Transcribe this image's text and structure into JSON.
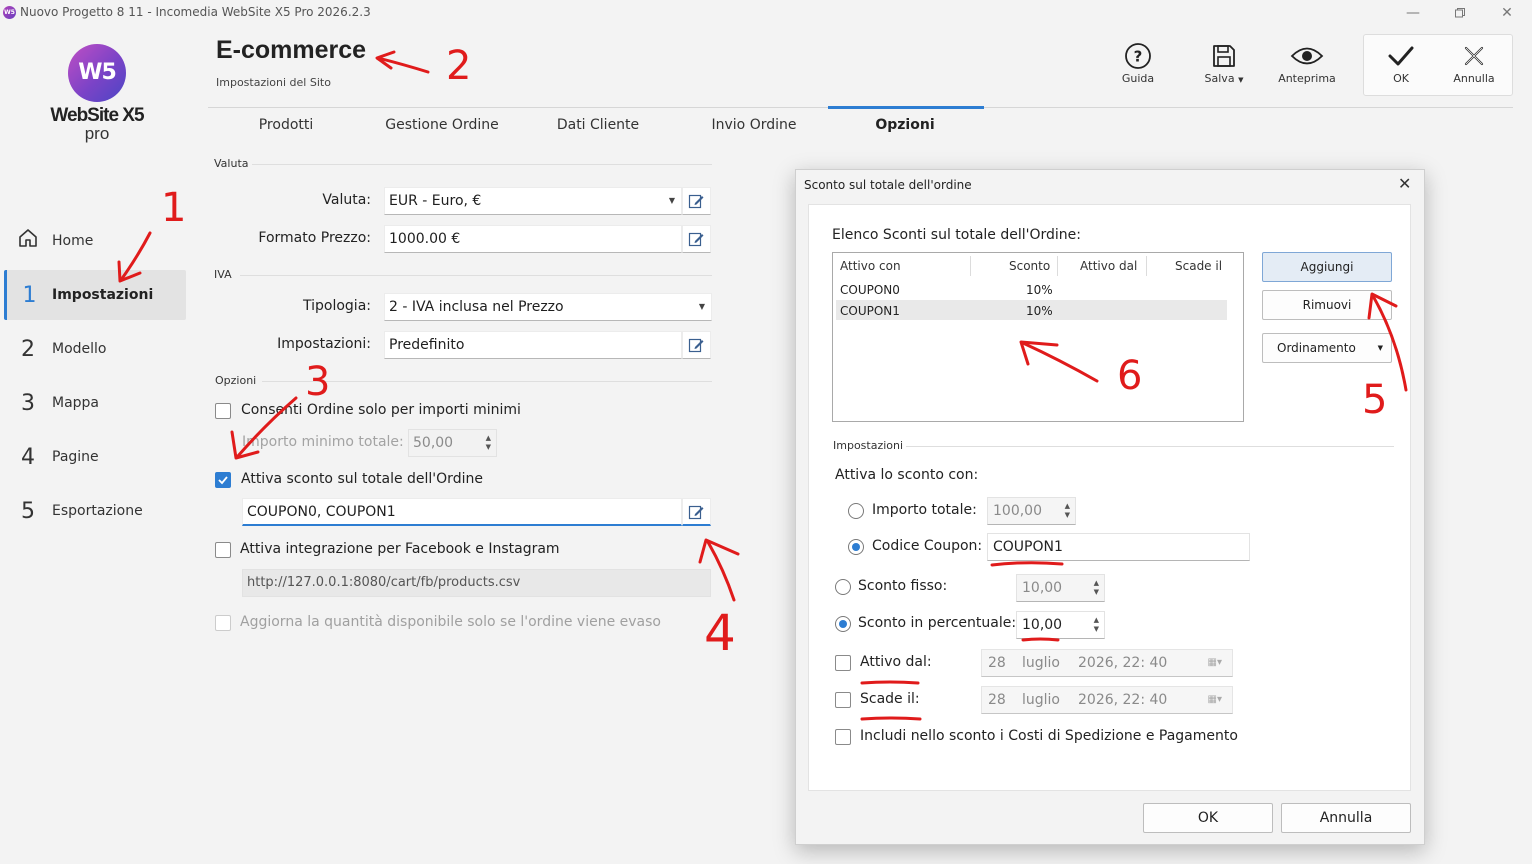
{
  "window": {
    "title": "Nuovo Progetto 8 11 - Incomedia WebSite X5 Pro 2026.2.3",
    "icon_label": "W5",
    "controls": [
      "minimize-icon",
      "restore-icon",
      "close-icon"
    ]
  },
  "logo": {
    "mark": "W5",
    "name": "WebSite X5",
    "edition": "pro"
  },
  "sidebar": {
    "items": [
      {
        "num": "",
        "label": "Home",
        "icon": "home-icon"
      },
      {
        "num": "1",
        "label": "Impostazioni"
      },
      {
        "num": "2",
        "label": "Modello"
      },
      {
        "num": "3",
        "label": "Mappa"
      },
      {
        "num": "4",
        "label": "Pagine"
      },
      {
        "num": "5",
        "label": "Esportazione"
      }
    ],
    "active_index": 1
  },
  "header": {
    "title": "E-commerce",
    "subtitle": "Impostazioni del Sito"
  },
  "toolbar": {
    "guida": "Guida",
    "salva": "Salva",
    "anteprima": "Anteprima",
    "ok": "OK",
    "annulla": "Annulla"
  },
  "tabs": [
    "Prodotti",
    "Gestione Ordine",
    "Dati Cliente",
    "Invio Ordine",
    "Opzioni"
  ],
  "form": {
    "valuta_section": "Valuta",
    "valuta_label": "Valuta:",
    "valuta_value": "EUR - Euro, €",
    "formato_label": "Formato Prezzo:",
    "formato_value": "1000.00 €",
    "iva_section": "IVA",
    "tipologia_label": "Tipologia:",
    "tipologia_value": "2 - IVA inclusa nel Prezzo",
    "impostazioni_label": "Impostazioni:",
    "impostazioni_value": "Predefinito",
    "opzioni_section": "Opzioni",
    "consenti_label": "Consenti Ordine solo per importi minimi",
    "consenti_checked": false,
    "importo_minimo_label": "Importo minimo totale:",
    "importo_minimo_value": "50,00",
    "attiva_sconto_label": "Attiva sconto sul totale dell'Ordine",
    "attiva_sconto_checked": true,
    "coupons_value": "COUPON0, COUPON1",
    "facebook_label": "Attiva integrazione per Facebook e Instagram",
    "facebook_checked": false,
    "facebook_url": "http://127.0.0.1:8080/cart/fb/products.csv",
    "aggiorna_label": "Aggiorna la quantità disponibile solo se l'ordine viene evaso"
  },
  "dialog": {
    "title": "Sconto sul totale dell'ordine",
    "list_heading": "Elenco Sconti sul totale dell'Ordine:",
    "columns": [
      "Attivo con",
      "Sconto",
      "Attivo dal",
      "Scade il"
    ],
    "rows": [
      {
        "attivo_con": "COUPON0",
        "sconto": "10%",
        "attivo_dal": "",
        "scade_il": ""
      },
      {
        "attivo_con": "COUPON1",
        "sconto": "10%",
        "attivo_dal": "",
        "scade_il": ""
      }
    ],
    "selected_row": 1,
    "btn_aggiungi": "Aggiungi",
    "btn_rimuovi": "Rimuovi",
    "btn_ordinamento": "Ordinamento",
    "impostazioni_section": "Impostazioni",
    "attiva_con_label": "Attiva lo sconto con:",
    "importo_totale_label": "Importo totale:",
    "importo_totale_value": "100,00",
    "codice_coupon_label": "Codice Coupon:",
    "codice_coupon_value": "COUPON1",
    "sconto_fisso_label": "Sconto fisso:",
    "sconto_fisso_value": "10,00",
    "sconto_perc_label": "Sconto in percentuale:",
    "sconto_perc_value": "10,00",
    "attivo_dal_label": "Attivo dal:",
    "attivo_dal_day": "28",
    "attivo_dal_month": "luglio",
    "attivo_dal_rest": "2026, 22: 40",
    "scade_il_label": "Scade il:",
    "scade_il_day": "28",
    "scade_il_month": "luglio",
    "scade_il_rest": "2026, 22: 40",
    "includi_label": "Includi nello sconto i Costi di Spedizione e Pagamento",
    "ok": "OK",
    "annulla": "Annulla"
  },
  "annotations": {
    "color": "#e01b1b",
    "numbers": [
      "1",
      "2",
      "3",
      "4",
      "5",
      "6"
    ]
  },
  "colors": {
    "accent": "#2d7dd2",
    "annotation": "#e01b1b"
  }
}
